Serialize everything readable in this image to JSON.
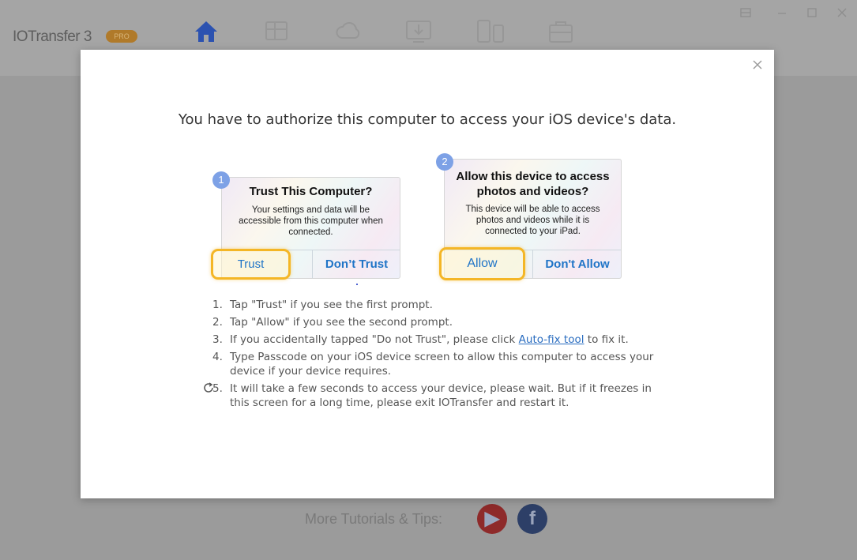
{
  "app": {
    "logo_text": "IOTransfer 3",
    "badge_text": "PRO",
    "nav_icons": [
      "home-icon",
      "grid-icon",
      "cloud-icon",
      "download-icon",
      "phone-transfer-icon",
      "toolbox-icon"
    ],
    "window_controls": [
      "account-icon",
      "minimize-icon",
      "maximize-icon",
      "close-window-icon"
    ],
    "footer_text": "More Tutorials & Tips:",
    "social": [
      "youtube-icon",
      "facebook-icon"
    ]
  },
  "modal": {
    "title": "You have to authorize this computer to access your iOS device's data.",
    "close_icon": "close-icon",
    "card1": {
      "badge": "1",
      "title": "Trust This Computer?",
      "desc": "Your settings and data will be accessible from this computer when connected.",
      "left_button": "Trust",
      "right_button": "Don’t Trust"
    },
    "card2": {
      "badge": "2",
      "title": "Allow this device to access photos and videos?",
      "desc": "This device will be able to access photos and videos while it is connected to your iPad.",
      "left_button": "Allow",
      "right_button": "Don't Allow"
    },
    "steps": [
      {
        "num": "1.",
        "text": "Tap \"Trust\" if you see the first prompt."
      },
      {
        "num": "2.",
        "text": "Tap \"Allow\" if you see the second prompt."
      },
      {
        "num": "3.",
        "pre": "If you accidentally tapped \"Do not Trust\", please click ",
        "link": "Auto-fix tool",
        "post": " to fix it."
      },
      {
        "num": "4.",
        "text": "Type Passcode on your iOS device screen to allow this computer to access your device if your device requires."
      },
      {
        "num": "5.",
        "text": "It will take a few seconds to access your device, please wait. But if it freezes in this screen for a long time, please exit IOTransfer and restart it."
      }
    ]
  },
  "colors": {
    "accent_blue": "#1f74c7",
    "highlight_yellow": "#f4b626",
    "badge_blue": "#7da1e6",
    "overlay_gray": "#9b9b9b"
  }
}
